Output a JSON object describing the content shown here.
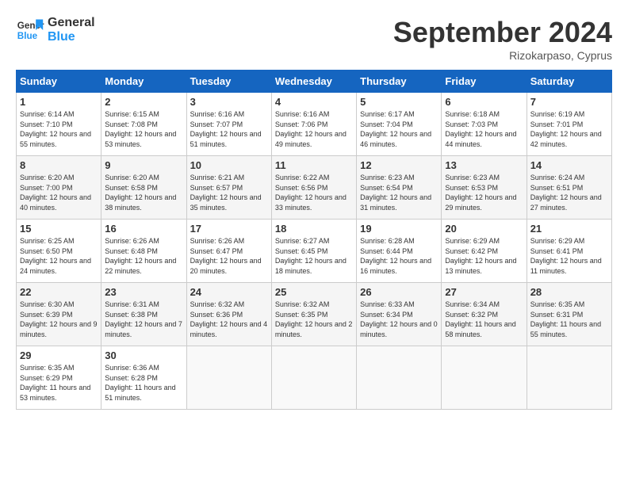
{
  "header": {
    "logo_line1": "General",
    "logo_line2": "Blue",
    "month": "September 2024",
    "location": "Rizokarpaso, Cyprus"
  },
  "weekdays": [
    "Sunday",
    "Monday",
    "Tuesday",
    "Wednesday",
    "Thursday",
    "Friday",
    "Saturday"
  ],
  "weeks": [
    [
      {
        "day": "1",
        "sunrise": "Sunrise: 6:14 AM",
        "sunset": "Sunset: 7:10 PM",
        "daylight": "Daylight: 12 hours and 55 minutes."
      },
      {
        "day": "2",
        "sunrise": "Sunrise: 6:15 AM",
        "sunset": "Sunset: 7:08 PM",
        "daylight": "Daylight: 12 hours and 53 minutes."
      },
      {
        "day": "3",
        "sunrise": "Sunrise: 6:16 AM",
        "sunset": "Sunset: 7:07 PM",
        "daylight": "Daylight: 12 hours and 51 minutes."
      },
      {
        "day": "4",
        "sunrise": "Sunrise: 6:16 AM",
        "sunset": "Sunset: 7:06 PM",
        "daylight": "Daylight: 12 hours and 49 minutes."
      },
      {
        "day": "5",
        "sunrise": "Sunrise: 6:17 AM",
        "sunset": "Sunset: 7:04 PM",
        "daylight": "Daylight: 12 hours and 46 minutes."
      },
      {
        "day": "6",
        "sunrise": "Sunrise: 6:18 AM",
        "sunset": "Sunset: 7:03 PM",
        "daylight": "Daylight: 12 hours and 44 minutes."
      },
      {
        "day": "7",
        "sunrise": "Sunrise: 6:19 AM",
        "sunset": "Sunset: 7:01 PM",
        "daylight": "Daylight: 12 hours and 42 minutes."
      }
    ],
    [
      {
        "day": "8",
        "sunrise": "Sunrise: 6:20 AM",
        "sunset": "Sunset: 7:00 PM",
        "daylight": "Daylight: 12 hours and 40 minutes."
      },
      {
        "day": "9",
        "sunrise": "Sunrise: 6:20 AM",
        "sunset": "Sunset: 6:58 PM",
        "daylight": "Daylight: 12 hours and 38 minutes."
      },
      {
        "day": "10",
        "sunrise": "Sunrise: 6:21 AM",
        "sunset": "Sunset: 6:57 PM",
        "daylight": "Daylight: 12 hours and 35 minutes."
      },
      {
        "day": "11",
        "sunrise": "Sunrise: 6:22 AM",
        "sunset": "Sunset: 6:56 PM",
        "daylight": "Daylight: 12 hours and 33 minutes."
      },
      {
        "day": "12",
        "sunrise": "Sunrise: 6:23 AM",
        "sunset": "Sunset: 6:54 PM",
        "daylight": "Daylight: 12 hours and 31 minutes."
      },
      {
        "day": "13",
        "sunrise": "Sunrise: 6:23 AM",
        "sunset": "Sunset: 6:53 PM",
        "daylight": "Daylight: 12 hours and 29 minutes."
      },
      {
        "day": "14",
        "sunrise": "Sunrise: 6:24 AM",
        "sunset": "Sunset: 6:51 PM",
        "daylight": "Daylight: 12 hours and 27 minutes."
      }
    ],
    [
      {
        "day": "15",
        "sunrise": "Sunrise: 6:25 AM",
        "sunset": "Sunset: 6:50 PM",
        "daylight": "Daylight: 12 hours and 24 minutes."
      },
      {
        "day": "16",
        "sunrise": "Sunrise: 6:26 AM",
        "sunset": "Sunset: 6:48 PM",
        "daylight": "Daylight: 12 hours and 22 minutes."
      },
      {
        "day": "17",
        "sunrise": "Sunrise: 6:26 AM",
        "sunset": "Sunset: 6:47 PM",
        "daylight": "Daylight: 12 hours and 20 minutes."
      },
      {
        "day": "18",
        "sunrise": "Sunrise: 6:27 AM",
        "sunset": "Sunset: 6:45 PM",
        "daylight": "Daylight: 12 hours and 18 minutes."
      },
      {
        "day": "19",
        "sunrise": "Sunrise: 6:28 AM",
        "sunset": "Sunset: 6:44 PM",
        "daylight": "Daylight: 12 hours and 16 minutes."
      },
      {
        "day": "20",
        "sunrise": "Sunrise: 6:29 AM",
        "sunset": "Sunset: 6:42 PM",
        "daylight": "Daylight: 12 hours and 13 minutes."
      },
      {
        "day": "21",
        "sunrise": "Sunrise: 6:29 AM",
        "sunset": "Sunset: 6:41 PM",
        "daylight": "Daylight: 12 hours and 11 minutes."
      }
    ],
    [
      {
        "day": "22",
        "sunrise": "Sunrise: 6:30 AM",
        "sunset": "Sunset: 6:39 PM",
        "daylight": "Daylight: 12 hours and 9 minutes."
      },
      {
        "day": "23",
        "sunrise": "Sunrise: 6:31 AM",
        "sunset": "Sunset: 6:38 PM",
        "daylight": "Daylight: 12 hours and 7 minutes."
      },
      {
        "day": "24",
        "sunrise": "Sunrise: 6:32 AM",
        "sunset": "Sunset: 6:36 PM",
        "daylight": "Daylight: 12 hours and 4 minutes."
      },
      {
        "day": "25",
        "sunrise": "Sunrise: 6:32 AM",
        "sunset": "Sunset: 6:35 PM",
        "daylight": "Daylight: 12 hours and 2 minutes."
      },
      {
        "day": "26",
        "sunrise": "Sunrise: 6:33 AM",
        "sunset": "Sunset: 6:34 PM",
        "daylight": "Daylight: 12 hours and 0 minutes."
      },
      {
        "day": "27",
        "sunrise": "Sunrise: 6:34 AM",
        "sunset": "Sunset: 6:32 PM",
        "daylight": "Daylight: 11 hours and 58 minutes."
      },
      {
        "day": "28",
        "sunrise": "Sunrise: 6:35 AM",
        "sunset": "Sunset: 6:31 PM",
        "daylight": "Daylight: 11 hours and 55 minutes."
      }
    ],
    [
      {
        "day": "29",
        "sunrise": "Sunrise: 6:35 AM",
        "sunset": "Sunset: 6:29 PM",
        "daylight": "Daylight: 11 hours and 53 minutes."
      },
      {
        "day": "30",
        "sunrise": "Sunrise: 6:36 AM",
        "sunset": "Sunset: 6:28 PM",
        "daylight": "Daylight: 11 hours and 51 minutes."
      },
      null,
      null,
      null,
      null,
      null
    ]
  ]
}
